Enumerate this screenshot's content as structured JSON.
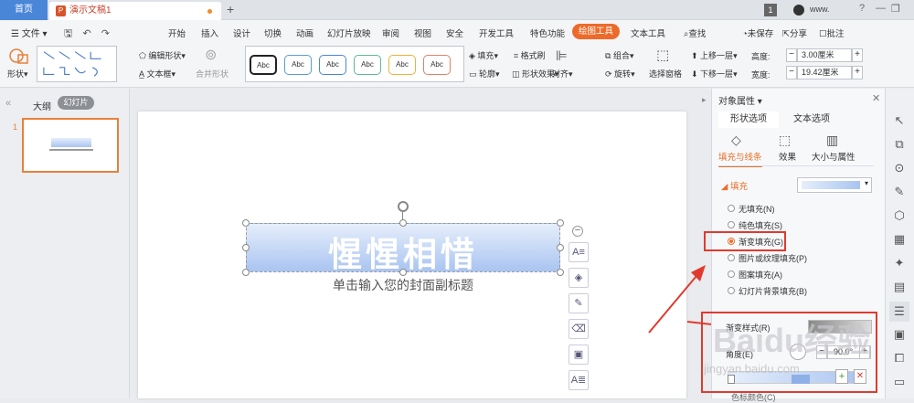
{
  "tabs": {
    "home": "首页",
    "doc": "演示文稿1",
    "add": "+"
  },
  "titlebar": {
    "page": "1",
    "user": "www.",
    "help": "?",
    "min": "—",
    "restore": "❐",
    "close": "✕"
  },
  "menu": {
    "file": "文件",
    "items": [
      "开始",
      "插入",
      "设计",
      "切换",
      "动画",
      "幻灯片放映",
      "审阅",
      "视图",
      "安全",
      "开发工具",
      "特色功能"
    ],
    "active": "绘图工具",
    "text_tool": "文本工具",
    "search": "查找",
    "unsaved": "未保存",
    "share": "分享",
    "comment": "批注"
  },
  "ribbon": {
    "shape": "形状",
    "edit_shape": "编辑形状",
    "text_box": "文本框",
    "merge_shape": "合并形状",
    "style_labels": [
      "Abc",
      "Abc",
      "Abc",
      "Abc",
      "Abc",
      "Abc"
    ],
    "style_colors": [
      "#222222",
      "#5b9bd5",
      "#4a86d8",
      "#5fb69a",
      "#f0b03a",
      "#e0806a"
    ],
    "fill": "填充",
    "format_brush": "格式刷",
    "outline": "轮廓",
    "shape_effect": "形状效果",
    "align": "对齐",
    "group": "组合",
    "rotate": "旋转",
    "select_pane": "选择窗格",
    "bring_forward": "上移一层",
    "send_backward": "下移一层",
    "height_label": "高度:",
    "height_value": "3.00厘米",
    "width_label": "宽度:",
    "width_value": "19.42厘米"
  },
  "leftpanel": {
    "outline": "大纲",
    "slides": "幻灯片",
    "slide_num": "1",
    "collapse": "«"
  },
  "slide": {
    "title": "惺惺相惜",
    "subtitle": "单击输入您的封面副标题"
  },
  "rightpanel": {
    "title": "对象属性",
    "tab_shape": "形状选项",
    "tab_text": "文本选项",
    "sub_fill": "填充与线条",
    "sub_effect": "效果",
    "sub_size": "大小与属性",
    "fill_header": "填充",
    "options": [
      "无填充(N)",
      "纯色填充(S)",
      "渐变填充(G)",
      "图片或纹理填充(P)",
      "图案填充(A)",
      "幻灯片背景填充(B)"
    ],
    "selected_option": 2,
    "gradient_style": "渐变样式(R)",
    "angle_label": "角度(E)",
    "angle_value": "90.0°",
    "next_label": "色标颜色(C)"
  },
  "watermark": {
    "text": "Baidu经验",
    "url": "jingyan.baidu.com"
  }
}
